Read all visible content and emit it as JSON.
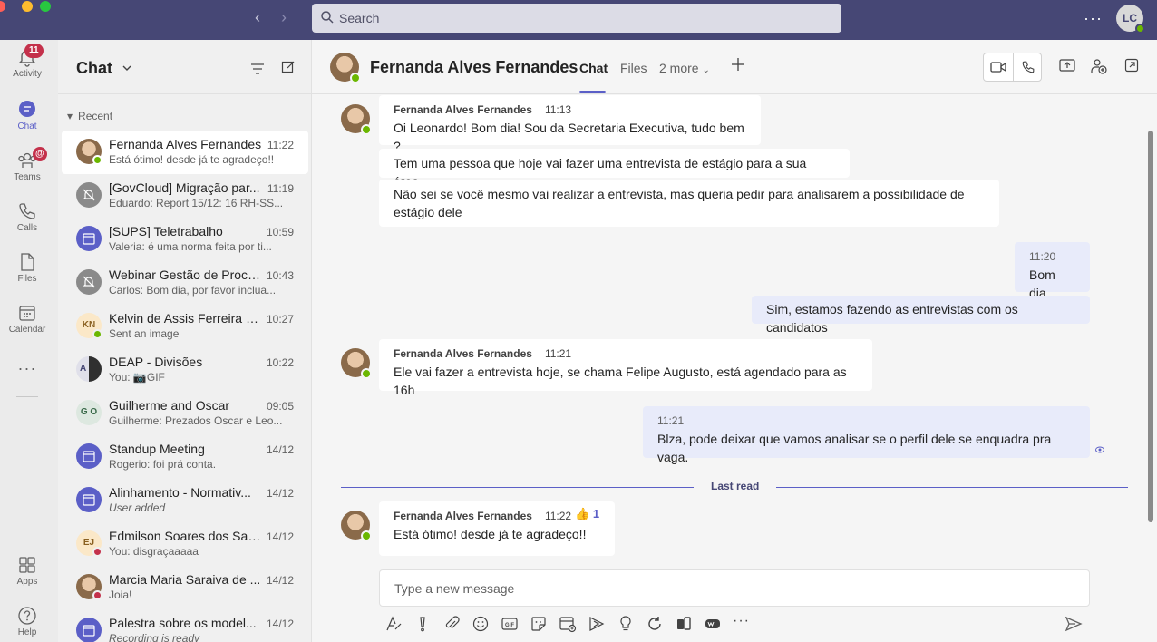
{
  "search": {
    "placeholder": "Search"
  },
  "user": {
    "initials": "LC"
  },
  "rail": [
    {
      "label": "Activity",
      "badge": "11"
    },
    {
      "label": "Chat"
    },
    {
      "label": "Teams",
      "badge": "@"
    },
    {
      "label": "Calls"
    },
    {
      "label": "Files"
    },
    {
      "label": "Calendar"
    },
    {
      "label": "Apps"
    },
    {
      "label": "Help"
    }
  ],
  "chatlist": {
    "title": "Chat",
    "section": "Recent",
    "items": [
      {
        "name": "Fernanda Alves Fernandes",
        "time": "11:22",
        "preview": "Está ótimo! desde já te agradeço!!"
      },
      {
        "name": "[GovCloud] Migração par...",
        "time": "11:19",
        "preview": "Eduardo: Report 15/12: 16 RH-SS..."
      },
      {
        "name": "[SUPS] Teletrabalho",
        "time": "10:59",
        "preview": "Valeria: é uma norma feita por ti..."
      },
      {
        "name": "Webinar Gestão de Proce...",
        "time": "10:43",
        "preview": "Carlos: Bom dia, por favor inclua..."
      },
      {
        "name": "Kelvin de Assis Ferreira d...",
        "time": "10:27",
        "preview": "Sent an image",
        "initials": "KN"
      },
      {
        "name": "DEAP - Divisões",
        "time": "10:22",
        "preview": "You: 📷GIF",
        "initials": "A"
      },
      {
        "name": "Guilherme and Oscar",
        "time": "09:05",
        "preview": "Guilherme: Prezados Oscar e Leo...",
        "initials": "G O"
      },
      {
        "name": "Standup Meeting",
        "time": "14/12",
        "preview": "Rogerio: foi prá conta."
      },
      {
        "name": "Alinhamento - Normativ...",
        "time": "14/12",
        "preview": "User added"
      },
      {
        "name": "Edmilson Soares dos San...",
        "time": "14/12",
        "preview": "You: disgraçaaaaa",
        "initials": "EJ"
      },
      {
        "name": "Marcia Maria Saraiva de ...",
        "time": "14/12",
        "preview": "Joia!"
      },
      {
        "name": "Palestra sobre os model...",
        "time": "14/12",
        "preview": "Recording is ready"
      }
    ]
  },
  "conversation": {
    "name": "Fernanda Alves Fernandes",
    "tabs": [
      "Chat",
      "Files",
      "2 more"
    ],
    "messages": [
      {
        "sender": "Fernanda Alves Fernandes",
        "time": "11:13",
        "text": "Oi Leonardo! Bom dia! Sou da Secretaria Executiva, tudo bem ?"
      },
      {
        "text": "Tem uma pessoa que hoje vai fazer uma entrevista de estágio para a sua área..."
      },
      {
        "text": "Não sei se você mesmo vai realizar a entrevista, mas queria pedir para analisarem a possibilidade de estágio dele"
      },
      {
        "time": "11:20",
        "text": "Bom dia"
      },
      {
        "text": "Sim, estamos fazendo as entrevistas com os candidatos"
      },
      {
        "sender": "Fernanda Alves Fernandes",
        "time": "11:21",
        "text": "Ele vai fazer a entrevista hoje, se chama Felipe Augusto, está agendado para as 16h"
      },
      {
        "time": "11:21",
        "text": "Blza, pode deixar que vamos analisar se o perfil dele se enquadra pra vaga."
      },
      {
        "sender": "Fernanda Alves Fernandes",
        "time": "11:22",
        "text": "Está ótimo! desde já te agradeço!!",
        "reaction": "👍",
        "reaction_count": "1"
      }
    ],
    "last_read": "Last read"
  },
  "compose": {
    "placeholder": "Type a new message"
  },
  "colors": {
    "titlebar": "#464775",
    "accent": "#5b5fc7",
    "mine_bubble": "#e8ebfa",
    "badge": "#c4314b",
    "online": "#6bb700",
    "busy": "#c4314b"
  }
}
